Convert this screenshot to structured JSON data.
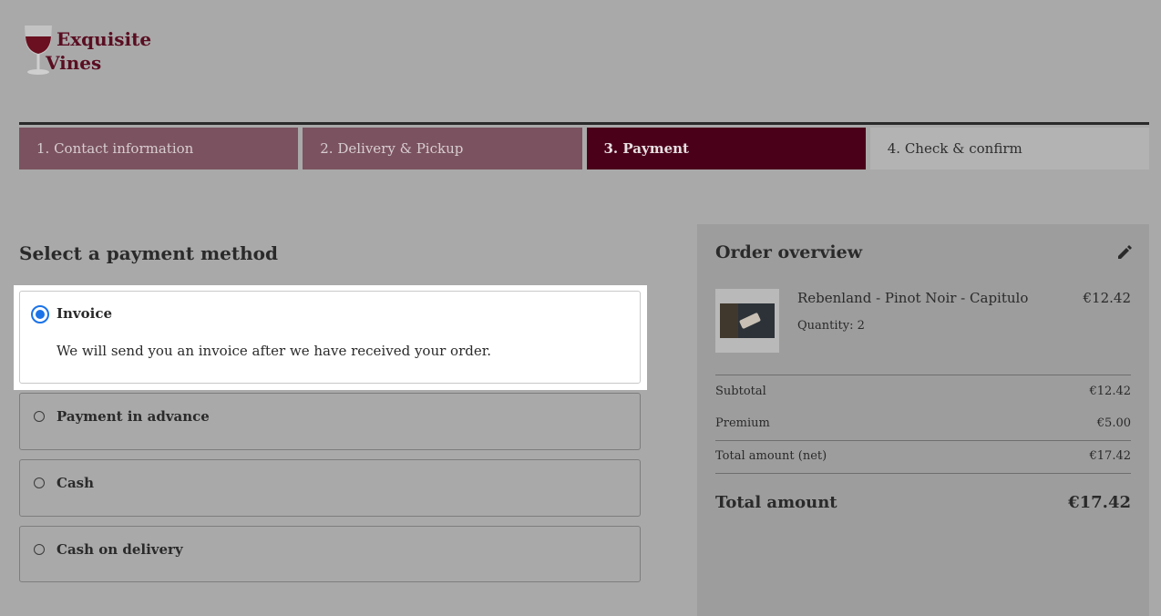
{
  "brand": {
    "line1": "Exquisite",
    "line2": "Vines"
  },
  "steps": [
    {
      "label": "1. Contact information"
    },
    {
      "label": "2. Delivery & Pickup"
    },
    {
      "label": "3. Payment"
    },
    {
      "label": "4. Check & confirm"
    }
  ],
  "payment": {
    "title": "Select a payment method",
    "options": [
      {
        "label": "Invoice",
        "description": "We will send you an invoice after we have received your order.",
        "selected": true
      },
      {
        "label": "Payment in advance",
        "selected": false
      },
      {
        "label": "Cash",
        "selected": false
      },
      {
        "label": "Cash on delivery",
        "selected": false
      }
    ]
  },
  "summary": {
    "title": "Order overview",
    "item": {
      "name": "Rebenland - Pinot Noir - Capitulo",
      "quantity": "Quantity: 2",
      "price": "€12.42"
    },
    "subtotal_label": "Subtotal",
    "subtotal_value": "€12.42",
    "premium_label": "Premium",
    "premium_value": "€5.00",
    "net_label": "Total amount (net)",
    "net_value": "€17.42",
    "total_label": "Total amount",
    "total_value": "€17.42"
  },
  "colors": {
    "brand": "#5a0e22",
    "active_step": "#4a0019",
    "done_step": "#7b5360",
    "radio": "#1a73e8"
  },
  "icons": {
    "logo": "wine-glass-icon",
    "edit": "pencil-icon"
  }
}
